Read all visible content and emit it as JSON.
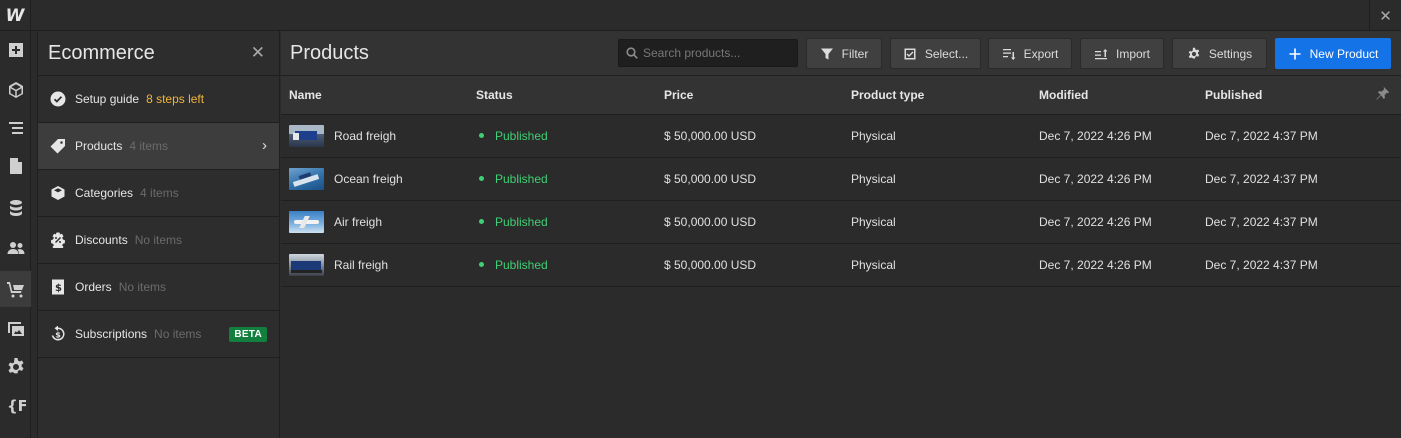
{
  "app": {
    "logo": "W",
    "close_symbol": "✕"
  },
  "rail": [
    {
      "name": "add-icon"
    },
    {
      "name": "box-icon"
    },
    {
      "name": "navigator-icon"
    },
    {
      "name": "pages-icon"
    },
    {
      "name": "cms-database-icon"
    },
    {
      "name": "users-icon"
    },
    {
      "name": "ecommerce-cart-icon",
      "active": true
    },
    {
      "name": "assets-icon"
    },
    {
      "name": "settings-gear-icon"
    },
    {
      "name": "apps-icon"
    }
  ],
  "panel": {
    "title": "Ecommerce",
    "close_symbol": "✕",
    "items": [
      {
        "label": "Setup guide",
        "sub": "8 steps left",
        "icon": "check-circle-icon",
        "warn": true
      },
      {
        "label": "Products",
        "sub": "4 items",
        "icon": "tag-icon",
        "active": true,
        "chevron": "›"
      },
      {
        "label": "Categories",
        "sub": "4 items",
        "icon": "cube-icon"
      },
      {
        "label": "Discounts",
        "sub": "No items",
        "icon": "discount-badge-icon"
      },
      {
        "label": "Orders",
        "sub": "No items",
        "icon": "receipt-icon"
      },
      {
        "label": "Subscriptions",
        "sub": "No items",
        "icon": "subscription-icon",
        "badge": "BETA"
      }
    ]
  },
  "main": {
    "title": "Products",
    "search": {
      "placeholder": "Search products..."
    },
    "buttons": {
      "filter": "Filter",
      "select": "Select...",
      "export": "Export",
      "import": "Import",
      "settings": "Settings",
      "new_product": "New Product"
    },
    "columns": [
      "Name",
      "Status",
      "Price",
      "Product type",
      "Modified",
      "Published"
    ],
    "rows": [
      {
        "name": "Road freigh",
        "status": "Published",
        "price": "$ 50,000.00 USD",
        "type": "Physical",
        "modified": "Dec 7, 2022 4:26 PM",
        "published": "Dec 7, 2022 4:37 PM"
      },
      {
        "name": "Ocean freigh",
        "status": "Published",
        "price": "$ 50,000.00 USD",
        "type": "Physical",
        "modified": "Dec 7, 2022 4:26 PM",
        "published": "Dec 7, 2022 4:37 PM"
      },
      {
        "name": "Air freigh",
        "status": "Published",
        "price": "$ 50,000.00 USD",
        "type": "Physical",
        "modified": "Dec 7, 2022 4:26 PM",
        "published": "Dec 7, 2022 4:37 PM"
      },
      {
        "name": "Rail freigh",
        "status": "Published",
        "price": "$ 50,000.00 USD",
        "type": "Physical",
        "modified": "Dec 7, 2022 4:26 PM",
        "published": "Dec 7, 2022 4:37 PM"
      }
    ]
  },
  "colors": {
    "accent": "#1473e6",
    "published": "#3fcf74",
    "warn": "#f0b43c",
    "beta": "#137f3e"
  }
}
